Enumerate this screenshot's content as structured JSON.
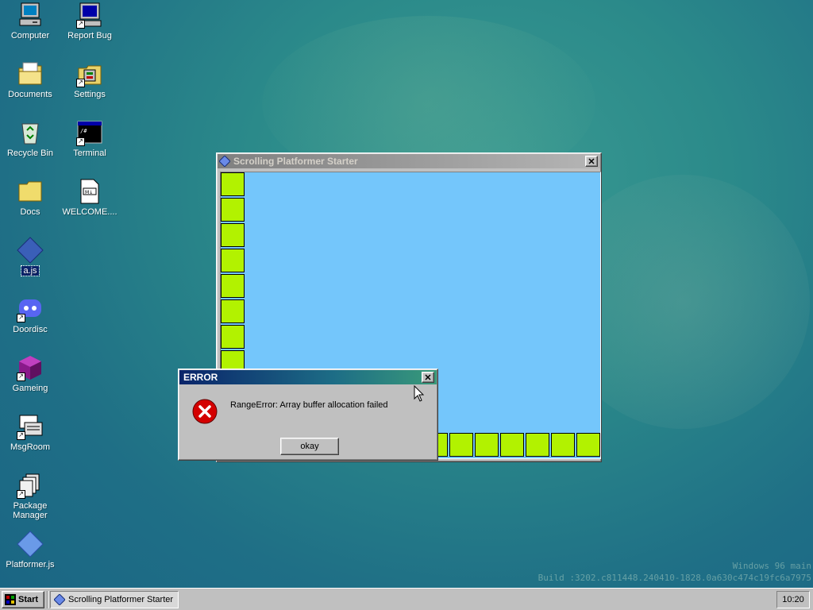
{
  "desktop": {
    "icons": [
      {
        "label": "Computer",
        "icon": "computer-icon"
      },
      {
        "label": "Report Bug",
        "icon": "report-bug-icon"
      },
      {
        "label": "Documents",
        "icon": "documents-folder-icon"
      },
      {
        "label": "Settings",
        "icon": "settings-icon"
      },
      {
        "label": "Recycle Bin",
        "icon": "recycle-bin-icon"
      },
      {
        "label": "Terminal",
        "icon": "terminal-icon"
      },
      {
        "label": "Docs",
        "icon": "docs-folder-icon"
      },
      {
        "label": "WELCOME....",
        "icon": "markdown-file-icon"
      },
      {
        "label": "a.js",
        "icon": "js-file-icon"
      },
      {
        "label": "Doordisc",
        "icon": "doordisc-icon"
      },
      {
        "label": "Gameing",
        "icon": "gameing-icon"
      },
      {
        "label": "MsgRoom",
        "icon": "msgroom-icon"
      },
      {
        "label": "Package Manager",
        "icon": "package-manager-icon"
      },
      {
        "label": "Platformer.js",
        "icon": "js-file-icon"
      }
    ]
  },
  "game_window": {
    "title": "Scrolling Platformer Starter",
    "close_label": "✕"
  },
  "error_dialog": {
    "title": "ERROR",
    "close_label": "✕",
    "message": "RangeError: Array buffer allocation failed",
    "button_label": "okay",
    "icon": "error-icon"
  },
  "watermark": {
    "line1": "Windows 96 main",
    "line2": "Build :3202.c811448.240410-1828.0a630c474c19fc6a7975"
  },
  "taskbar": {
    "start_label": "Start",
    "tasks": [
      {
        "label": "Scrolling Platformer Starter"
      }
    ],
    "clock": "10:20"
  },
  "colors": {
    "sky": "#74c6fb",
    "tile": "#b2f200",
    "window_gray": "#c0c0c0",
    "error_red": "#d40000"
  }
}
